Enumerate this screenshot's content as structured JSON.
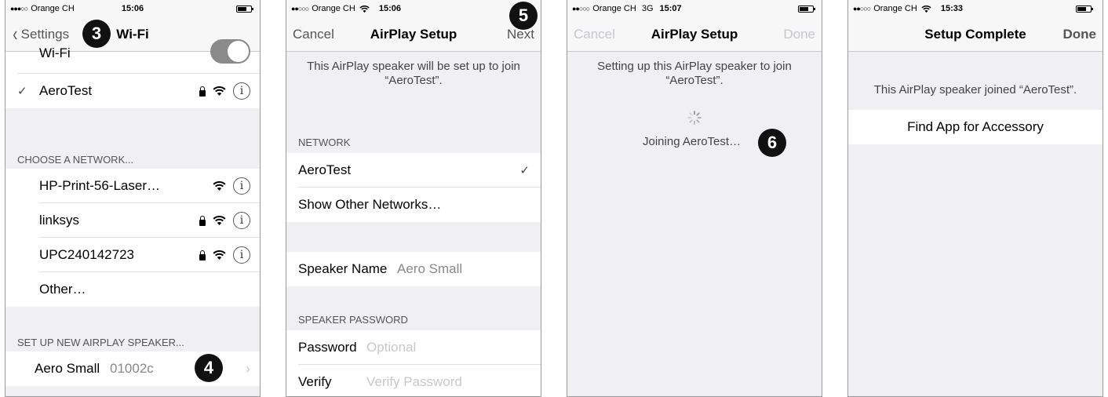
{
  "screen1": {
    "status": {
      "carrier": "Orange CH",
      "time": "15:06"
    },
    "nav": {
      "back_label": "Settings",
      "title": "Wi-Fi"
    },
    "wifi_row_label": "Wi-Fi",
    "connected": {
      "check": "✓",
      "name": "AeroTest"
    },
    "choose_header": "CHOOSE A NETWORK...",
    "networks": [
      {
        "name": "HP-Print-56-Laser…",
        "locked": false
      },
      {
        "name": "linksys",
        "locked": true
      },
      {
        "name": "UPC240142723",
        "locked": true
      }
    ],
    "other_label": "Other…",
    "airplay_header": "SET UP NEW AIRPLAY SPEAKER...",
    "speaker": {
      "name": "Aero Small",
      "id": "01002c"
    },
    "badge_top": "3",
    "badge_bottom": "4"
  },
  "screen2": {
    "status": {
      "carrier": "Orange CH",
      "time": "15:06"
    },
    "nav": {
      "left": "Cancel",
      "title": "AirPlay Setup",
      "right": "Next"
    },
    "intro": "This AirPlay speaker will be set up to join “AeroTest”.",
    "network_header": "NETWORK",
    "network_selected": "AeroTest",
    "check": "✓",
    "show_other": "Show Other Networks…",
    "speaker_name_label": "Speaker Name",
    "speaker_name_value": "Aero Small",
    "password_header": "SPEAKER PASSWORD",
    "password_label": "Password",
    "password_placeholder": "Optional",
    "verify_label": "Verify",
    "verify_placeholder": "Verify Password",
    "badge": "5"
  },
  "screen3": {
    "status": {
      "carrier": "Orange CH",
      "network": "3G",
      "time": "15:07"
    },
    "nav": {
      "left": "Cancel",
      "title": "AirPlay Setup",
      "right": "Done"
    },
    "message": "Setting up this AirPlay speaker to join “AeroTest”.",
    "joining": "Joining AeroTest…",
    "badge": "6"
  },
  "screen4": {
    "status": {
      "carrier": "Orange CH",
      "time": "15:33"
    },
    "nav": {
      "title": "Setup Complete",
      "right": "Done"
    },
    "message": "This AirPlay speaker joined “AeroTest”.",
    "find_app": "Find App for Accessory"
  },
  "colors": {
    "background": "#efeff4",
    "row": "#ffffff",
    "badge": "#111111",
    "disabled": "#c7c7cc"
  },
  "icons": [
    "wifi-signal-icon",
    "lock-icon",
    "info-icon",
    "checkmark-icon",
    "chevron-left-icon",
    "chevron-right-icon",
    "spinner-icon",
    "battery-icon"
  ]
}
